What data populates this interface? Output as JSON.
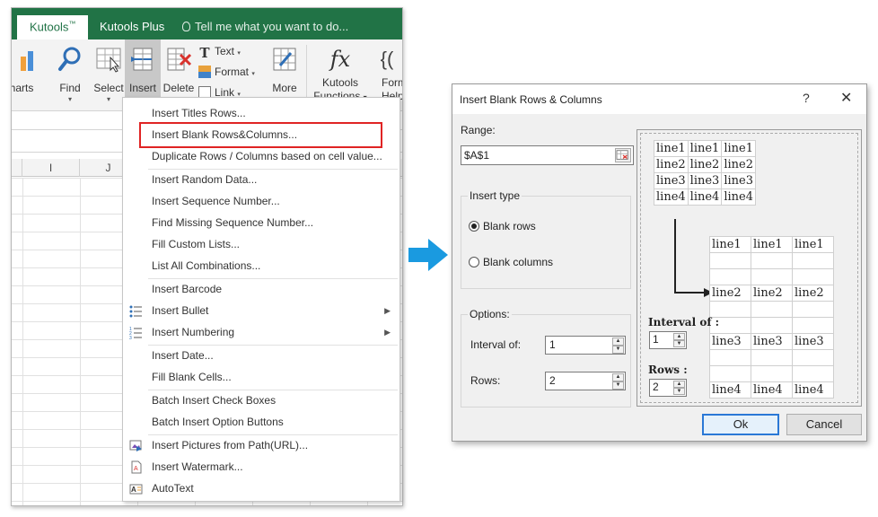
{
  "excel": {
    "tabs": [
      {
        "label": "Kutools",
        "sup": "™"
      },
      {
        "label": "Kutools Plus"
      }
    ],
    "tell_me": "Tell me what you want to do...",
    "ribbon": {
      "charts": "harts",
      "find": "Find",
      "select": "Select",
      "insert": "Insert",
      "delete": "Delete",
      "text": "Text",
      "format": "Format",
      "link": "Link",
      "more": "More",
      "kutools_functions_1": "Kutools",
      "kutools_functions_2": "Functions",
      "formula_1": "Form",
      "formula_2": "Help"
    },
    "columns": [
      "I",
      "J"
    ]
  },
  "menu": {
    "items": [
      "Insert Titles Rows...",
      "Insert Blank Rows&Columns...",
      "Duplicate Rows / Columns based on cell value...",
      "Insert Random Data...",
      "Insert Sequence Number...",
      "Find Missing Sequence Number...",
      "Fill Custom Lists...",
      "List All Combinations...",
      "Insert Barcode",
      "Insert Bullet",
      "Insert Numbering",
      "Insert Date...",
      "Fill Blank Cells...",
      "Batch Insert Check Boxes",
      "Batch Insert Option Buttons",
      "Insert Pictures from Path(URL)...",
      "Insert Watermark...",
      "AutoText"
    ]
  },
  "dialog": {
    "title": "Insert Blank Rows & Columns",
    "help": "?",
    "close": "✕",
    "range_label": "Range:",
    "range_value": "$A$1",
    "insert_type_label": "Insert type",
    "blank_rows": "Blank rows",
    "blank_columns": "Blank columns",
    "selected_type": "blank_rows",
    "options_label": "Options:",
    "interval_label": "Interval of:",
    "interval_value": "1",
    "rows_label": "Rows:",
    "rows_value": "2",
    "ok": "Ok",
    "cancel": "Cancel",
    "preview": {
      "source": [
        [
          "line1",
          "line1",
          "line1"
        ],
        [
          "line2",
          "line2",
          "line2"
        ],
        [
          "line3",
          "line3",
          "line3"
        ],
        [
          "line4",
          "line4",
          "line4"
        ]
      ],
      "result": [
        [
          "line1",
          "line1",
          "line1"
        ],
        [
          "",
          "",
          ""
        ],
        [
          "",
          "",
          ""
        ],
        [
          "line2",
          "line2",
          "line2"
        ],
        [
          "",
          "",
          ""
        ],
        [
          "",
          "",
          ""
        ],
        [
          "line3",
          "line3",
          "line3"
        ],
        [
          "",
          "",
          ""
        ],
        [
          "",
          "",
          ""
        ],
        [
          "line4",
          "line4",
          "line4"
        ]
      ],
      "interval_label": "Interval of :",
      "interval_value": "1",
      "rows_label": "Rows :",
      "rows_value": "2"
    }
  }
}
